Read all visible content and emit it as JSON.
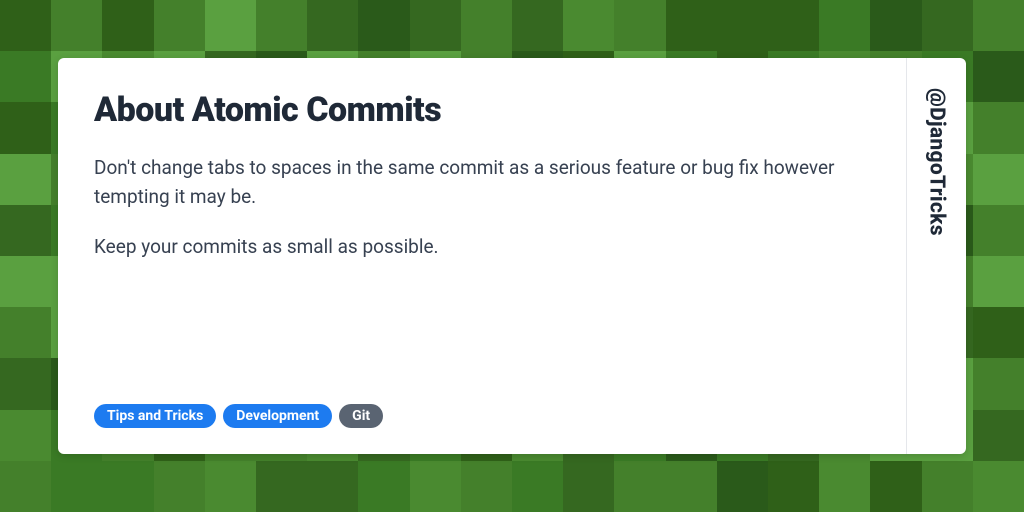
{
  "card": {
    "title": "About Atomic Commits",
    "paragraphs": [
      "Don't change tabs to spaces in the same commit as a serious feature or bug fix however tempting it may be.",
      "Keep your commits as small as possible."
    ],
    "tags": [
      {
        "label": "Tips and Tricks",
        "style": "blue"
      },
      {
        "label": "Development",
        "style": "blue"
      },
      {
        "label": "Git",
        "style": "gray"
      }
    ],
    "handle": "@DjangoTricks"
  },
  "colors": {
    "bgGreens": [
      "#2a5a1a",
      "#3a7a25",
      "#4a8a30",
      "#5aa040",
      "#356820",
      "#44802b",
      "#2f6018"
    ]
  }
}
